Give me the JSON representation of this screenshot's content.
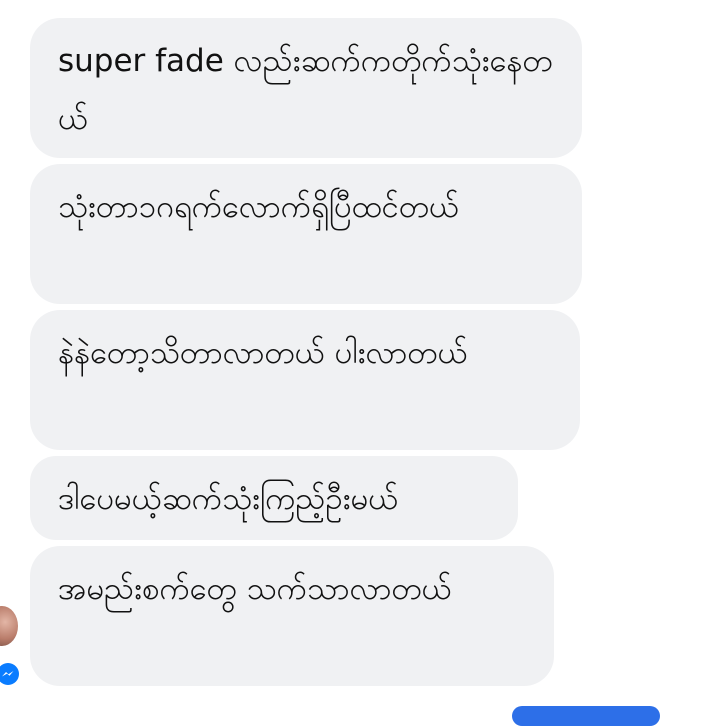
{
  "messages": [
    {
      "text": "super fade လည်းဆက်ကတိုက်သုံးနေတယ်"
    },
    {
      "text": "သုံးတာ၁ဂရက်လောက်ရှိပြီထင်တယ်"
    },
    {
      "text": "နဲနဲတော့သိတာလာတယ် ပါးလာတယ်"
    },
    {
      "text": "ဒါပေမယ့်ဆက်သုံးကြည့်ဦးမယ်"
    },
    {
      "text": "အမည်းစက်တွေ သက်သာလာတယ်"
    }
  ],
  "sender": {
    "badge_icon": "messenger-icon",
    "badge_color": "#0a7cff"
  },
  "colors": {
    "bubble_bg": "#f0f1f3",
    "text": "#111111",
    "accent": "#2d6fe8"
  }
}
